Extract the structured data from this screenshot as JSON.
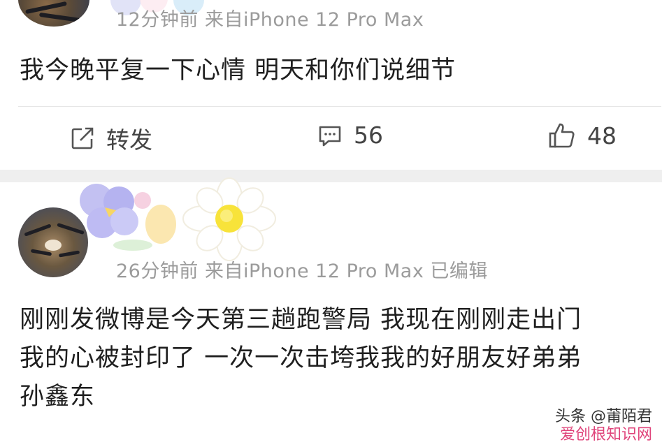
{
  "post1": {
    "meta": "12分钟前 来自iPhone 12 Pro Max",
    "text": "我今晚平复一下心情 明天和你们说细节",
    "actions": {
      "repost_label": "转发",
      "repost_icon": "edit-square-icon",
      "comment_count": "56",
      "comment_icon": "comment-bubble-icon",
      "like_count": "48",
      "like_icon": "thumbs-up-icon"
    }
  },
  "post2": {
    "meta": "26分钟前 来自iPhone 12 Pro Max 已编辑",
    "lines": [
      "刚刚发微博是今天第三趟跑警局 我现在刚刚走出门",
      "我的心被封印了 一次一次击垮我我的好朋友好弟弟",
      " 孙鑫东"
    ]
  },
  "watermark": {
    "top": "头条 @莆陌君",
    "bottom": "爱创根知识网"
  },
  "colors": {
    "meta_text": "#9b9b9b",
    "body_text": "#1f1f1f",
    "separator_band": "#efefef",
    "watermark_accent": "#e0457b"
  }
}
